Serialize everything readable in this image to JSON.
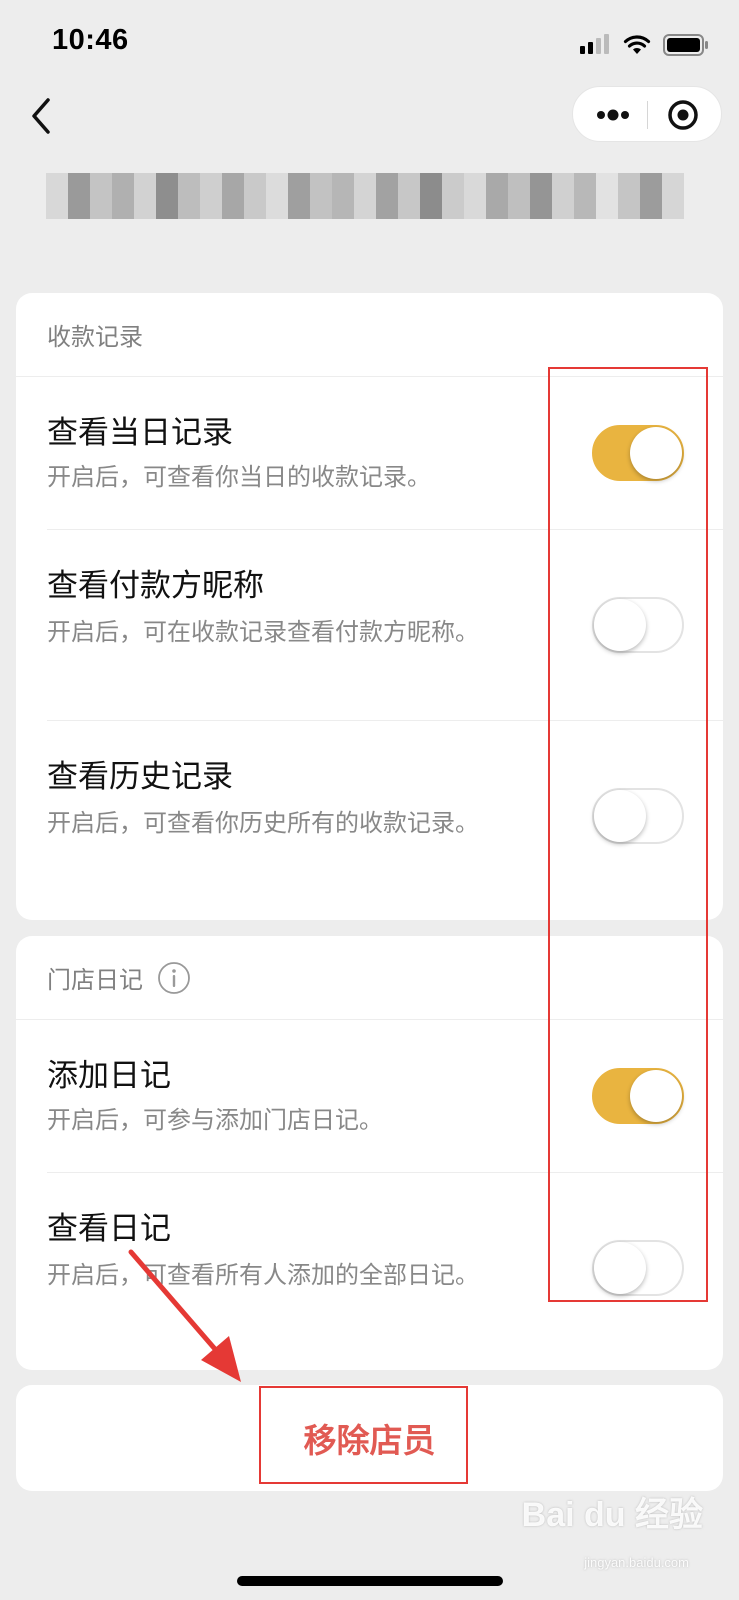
{
  "status_bar": {
    "time": "10:46"
  },
  "nav": {
    "more_icon": "more-dots-icon",
    "close_icon": "target-circle-icon",
    "back_icon": "chevron-left-icon"
  },
  "sections": [
    {
      "header": "收款记录",
      "rows": [
        {
          "title": "查看当日记录",
          "desc": "开启后，可查看你当日的收款记录。",
          "enabled": true
        },
        {
          "title": "查看付款方昵称",
          "desc": "开启后，可在收款记录查看付款方昵称。",
          "enabled": false
        },
        {
          "title": "查看历史记录",
          "desc": "开启后，可查看你历史所有的收款记录。",
          "enabled": false
        }
      ]
    },
    {
      "header": "门店日记",
      "rows": [
        {
          "title": "添加日记",
          "desc": "开启后，可参与添加门店日记。",
          "enabled": true
        },
        {
          "title": "查看日记",
          "desc": "开启后，可查看所有人添加的全部日记。",
          "enabled": false
        }
      ]
    }
  ],
  "remove_button": "移除店员",
  "watermark": {
    "main": "Bai du 经验",
    "sub": "jingyan.baidu.com"
  },
  "colors": {
    "toggle_on": "#e9b440",
    "danger": "#e15a53",
    "annotation": "#e53935",
    "background": "#ededed"
  }
}
